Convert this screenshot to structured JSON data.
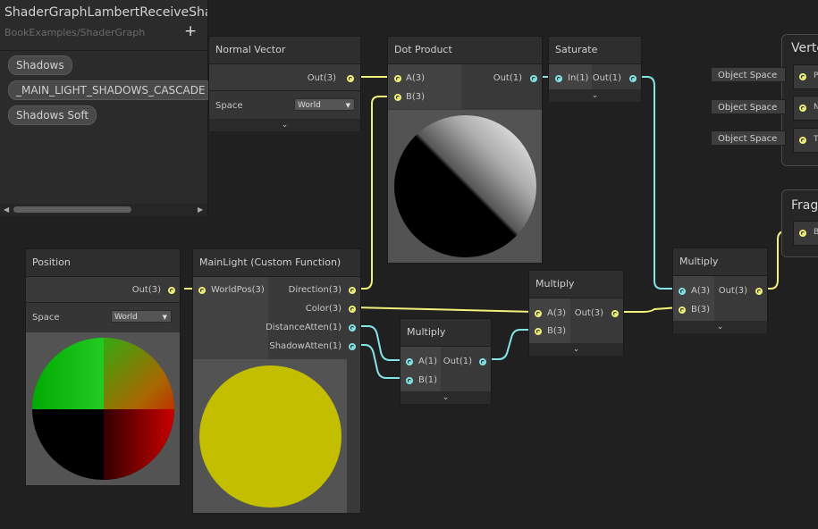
{
  "blackboard": {
    "title": "ShaderGraphLambertReceiveShad",
    "subtitle": "BookExamples/ShaderGraph",
    "add_icon": "+",
    "keywords": [
      "Shadows",
      "_MAIN_LIGHT_SHADOWS_CASCADE",
      "Shadows Soft"
    ],
    "scroll_left": "◀",
    "scroll_right": "▶"
  },
  "nodes": {
    "normal_vector": {
      "title": "Normal Vector",
      "out": "Out(3)",
      "field_label": "Space",
      "field_value": "World"
    },
    "dot_product": {
      "title": "Dot Product",
      "in_a": "A(3)",
      "in_b": "B(3)",
      "out": "Out(1)"
    },
    "saturate": {
      "title": "Saturate",
      "in": "In(1)",
      "out": "Out(1)"
    },
    "position": {
      "title": "Position",
      "out": "Out(3)",
      "field_label": "Space",
      "field_value": "World"
    },
    "main_light": {
      "title": "MainLight (Custom Function)",
      "in": "WorldPos(3)",
      "outs": [
        "Direction(3)",
        "Color(3)",
        "DistanceAtten(1)",
        "ShadowAtten(1)"
      ]
    },
    "multiply_1": {
      "title": "Multiply",
      "in_a": "A(1)",
      "in_b": "B(1)",
      "out": "Out(1)"
    },
    "multiply_2": {
      "title": "Multiply",
      "in_a": "A(3)",
      "in_b": "B(3)",
      "out": "Out(3)"
    },
    "multiply_3": {
      "title": "Multiply",
      "in_a": "A(3)",
      "in_b": "B(3)",
      "out": "Out(3)"
    }
  },
  "master": {
    "vertex_title": "Verte",
    "vertex_slots": [
      "P",
      "N",
      "T"
    ],
    "vertex_spaces": [
      "Object Space",
      "Object Space",
      "Object Space"
    ],
    "fragment_title": "Frag",
    "fragment_slots": [
      "B"
    ]
  },
  "collapse_icon": "⌄",
  "dropdown_caret": "▼",
  "colors": {
    "vector_port": "#f0f07a",
    "float_port": "#84e4e7",
    "background": "#202020"
  }
}
